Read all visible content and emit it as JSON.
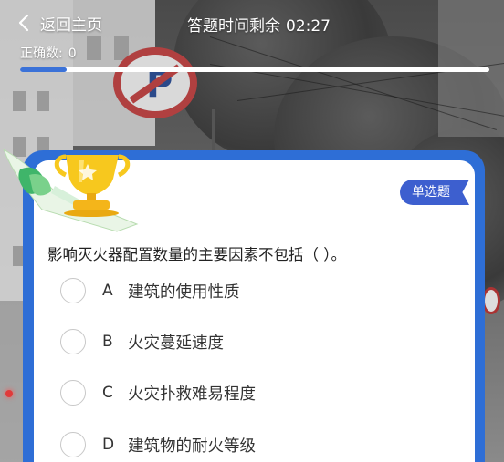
{
  "header": {
    "back_label": "返回主页",
    "timer_label": "答题时间剩余",
    "timer_value": "02:27",
    "correct_label": "正确数:",
    "correct_value": "0",
    "progress": 0.1
  },
  "question": {
    "type_badge": "单选题",
    "text": "影响灭火器配置数量的主要因素不包括（  ）。",
    "options": [
      {
        "letter": "A",
        "text": "建筑的使用性质"
      },
      {
        "letter": "B",
        "text": "火灾蔓延速度"
      },
      {
        "letter": "C",
        "text": "火灾扑救难易程度"
      },
      {
        "letter": "D",
        "text": "建筑物的耐火等级"
      }
    ]
  },
  "colors": {
    "accent": "#2e6ed6",
    "badge": "#3d5fcf",
    "progress_fill": "#3b72d8"
  },
  "icons": {
    "back": "chevron-left-icon",
    "decoration": "trophy-icon"
  }
}
